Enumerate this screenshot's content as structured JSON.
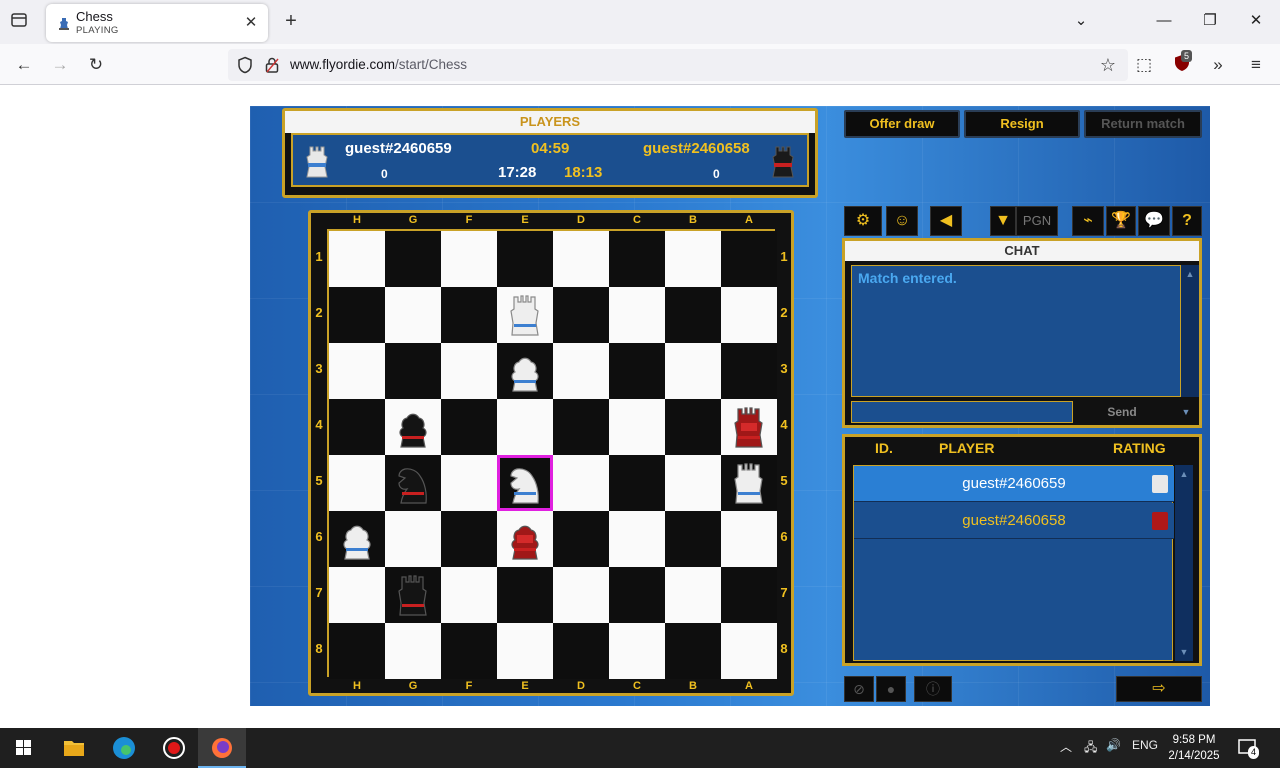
{
  "browser": {
    "tab_title": "Chess",
    "tab_subtitle": "PLAYING",
    "url_host": "www.flyordie.com",
    "url_path": "/start/Chess",
    "extension_badge": "5"
  },
  "game": {
    "players_header": "PLAYERS",
    "player1": {
      "name": "guest#2460659",
      "time_move": "04:59",
      "time_total": "17:28",
      "score": "0"
    },
    "player2": {
      "name": "guest#2460658",
      "time_total": "18:13",
      "score": "0"
    },
    "buttons": {
      "offer_draw": "Offer draw",
      "resign": "Resign",
      "return_match": "Return match"
    },
    "toolbar": {
      "pgn": "PGN"
    },
    "files": [
      "H",
      "G",
      "F",
      "E",
      "D",
      "C",
      "B",
      "A"
    ],
    "ranks": [
      "1",
      "2",
      "3",
      "4",
      "5",
      "6",
      "7",
      "8"
    ],
    "pieces": [
      {
        "square": "E2",
        "color": "white",
        "type": "rook"
      },
      {
        "square": "E3",
        "color": "white",
        "type": "pawn"
      },
      {
        "square": "G4",
        "color": "black",
        "type": "pawn"
      },
      {
        "square": "A4",
        "color": "red",
        "type": "rook"
      },
      {
        "square": "G5",
        "color": "black",
        "type": "knight"
      },
      {
        "square": "E5",
        "color": "white",
        "type": "knight",
        "selected": true
      },
      {
        "square": "A5",
        "color": "white",
        "type": "rook"
      },
      {
        "square": "H6",
        "color": "white",
        "type": "pawn"
      },
      {
        "square": "E6",
        "color": "red",
        "type": "pawn"
      },
      {
        "square": "G7",
        "color": "black",
        "type": "rook"
      }
    ],
    "chat": {
      "header": "CHAT",
      "message": "Match entered.",
      "send_label": "Send"
    },
    "player_list": {
      "headers": {
        "id": "ID.",
        "player": "PLAYER",
        "rating": "RATING"
      },
      "rows": [
        {
          "name": "guest#2460659",
          "highlight": true
        },
        {
          "name": "guest#2460658",
          "highlight": false
        }
      ]
    }
  },
  "taskbar": {
    "language": "ENG",
    "time": "9:58 PM",
    "date": "2/14/2025",
    "notification_count": "4"
  }
}
